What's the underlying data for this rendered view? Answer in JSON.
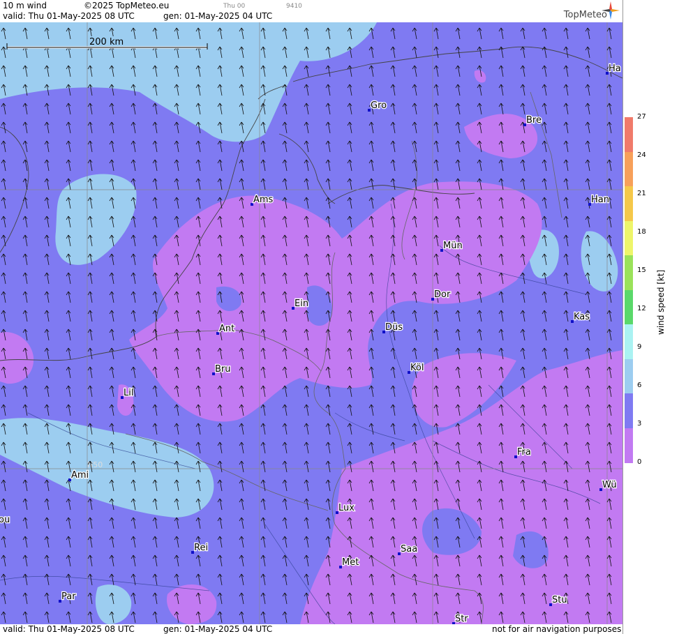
{
  "header": {
    "title": "10 m wind",
    "copyright": "©2025 TopMeteo.eu",
    "day_small": "Thu 00",
    "code_small": "9410",
    "valid_line": "valid:  Thu  01-May-2025  08 UTC",
    "gen_line": "gen: 01-May-2025 04 UTC",
    "brand": "TopMeteo"
  },
  "footer": {
    "valid_line": "valid:  Thu  01-May-2025  08 UTC",
    "gen_line": "gen: 01-May-2025 04 UTC",
    "disclaimer": "not for air navigation purposes"
  },
  "scale_bar": {
    "label": "200 km"
  },
  "gridline_label": "N50",
  "legend": {
    "unit": "wind  speed  [kt]",
    "ticks": [
      "27",
      "24",
      "21",
      "18",
      "15",
      "12",
      "9",
      "6",
      "3",
      "0"
    ],
    "colors": [
      "#f07a6a",
      "#f7a05a",
      "#f5c84a",
      "#eef56a",
      "#9ae25a",
      "#5ad86a",
      "#aaf2f2",
      "#9ccdf0",
      "#7f7af2",
      "#c27af2"
    ]
  },
  "cities": [
    {
      "name": "Ha"
    },
    {
      "name": "Gro"
    },
    {
      "name": "Bre"
    },
    {
      "name": "Ams"
    },
    {
      "name": "Han"
    },
    {
      "name": "Mün"
    },
    {
      "name": "Dor"
    },
    {
      "name": "Ein"
    },
    {
      "name": "Kas"
    },
    {
      "name": "Düs"
    },
    {
      "name": "Ant"
    },
    {
      "name": "Bru"
    },
    {
      "name": "Köl"
    },
    {
      "name": "Lil"
    },
    {
      "name": "Fra"
    },
    {
      "name": "Ami"
    },
    {
      "name": "Wü"
    },
    {
      "name": "Lux"
    },
    {
      "name": "ou"
    },
    {
      "name": "Rei"
    },
    {
      "name": "Saa"
    },
    {
      "name": "Met"
    },
    {
      "name": "Par"
    },
    {
      "name": "Stu"
    },
    {
      "name": "Str"
    }
  ]
}
